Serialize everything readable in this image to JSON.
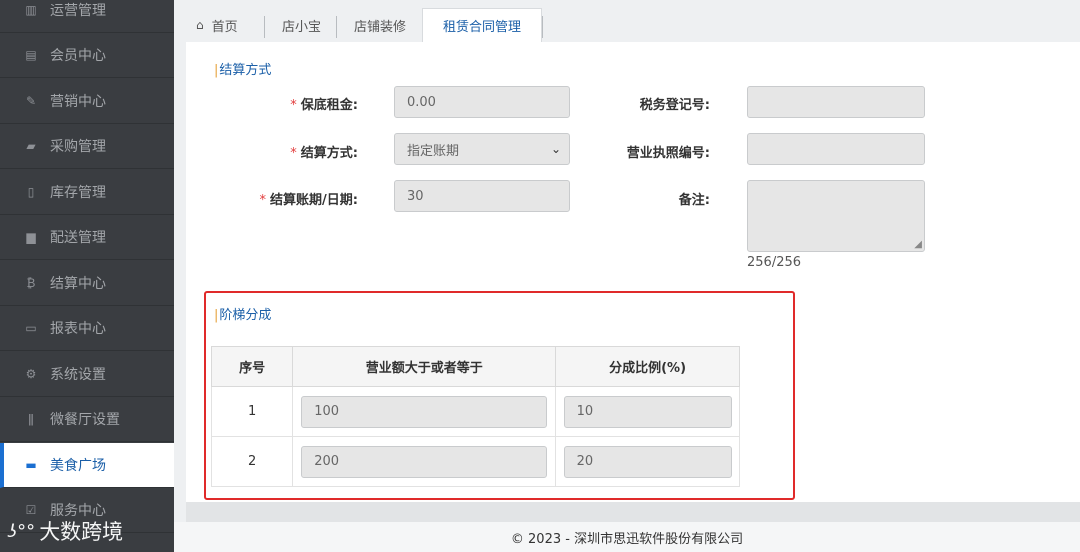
{
  "sidebar": {
    "items": [
      {
        "label": "运营管理",
        "icon": "bar-chart-icon"
      },
      {
        "label": "会员中心",
        "icon": "id-card-icon"
      },
      {
        "label": "营销中心",
        "icon": "edit-icon"
      },
      {
        "label": "采购管理",
        "icon": "book-icon"
      },
      {
        "label": "库存管理",
        "icon": "clipboard-icon"
      },
      {
        "label": "配送管理",
        "icon": "truck-icon"
      },
      {
        "label": "结算中心",
        "icon": "bitcoin-icon"
      },
      {
        "label": "报表中心",
        "icon": "file-icon"
      },
      {
        "label": "系统设置",
        "icon": "gears-icon"
      },
      {
        "label": "微餐厅设置",
        "icon": "cutlery-icon"
      },
      {
        "label": "美食广场",
        "icon": "monitor-icon",
        "active": true
      },
      {
        "label": "服务中心",
        "icon": "checkbox-icon"
      }
    ]
  },
  "tabs": [
    {
      "label": "首页",
      "icon": "home-icon"
    },
    {
      "label": "店小宝"
    },
    {
      "label": "店铺装修"
    },
    {
      "label": "租赁合同管理",
      "active": true
    }
  ],
  "settlement": {
    "title": "结算方式",
    "deposit": {
      "label": "保底租金:",
      "value": "0.00",
      "required": "*"
    },
    "method": {
      "label": "结算方式:",
      "value": "指定账期",
      "required": "*"
    },
    "period": {
      "label": "结算账期/日期:",
      "value": "30",
      "required": "*"
    },
    "tax": {
      "label": "税务登记号:",
      "value": ""
    },
    "license": {
      "label": "营业执照编号:",
      "value": ""
    },
    "remark": {
      "label": "备注:",
      "value": "",
      "counter": "256/256"
    }
  },
  "tier": {
    "title": "阶梯分成",
    "columns": [
      "序号",
      "营业额大于或者等于",
      "分成比例(%)"
    ],
    "rows": [
      {
        "index": "1",
        "amount": "100",
        "ratio": "10"
      },
      {
        "index": "2",
        "amount": "200",
        "ratio": "20"
      }
    ]
  },
  "footer": "© 2023 - 深圳市思迅软件股份有限公司",
  "watermark": "大数跨境",
  "colors": {
    "accent": "#1b5fa8",
    "sidebar_bg": "#3a3d41",
    "highlight_border": "#e02a2a",
    "required": "#e23b3b"
  }
}
